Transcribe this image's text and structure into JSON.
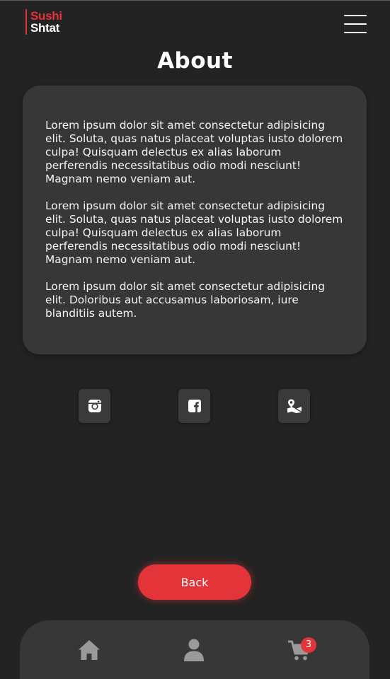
{
  "header": {
    "logo_line1": "Sushi",
    "logo_line2": "Shtat",
    "menu_icon": "hamburger-menu-icon"
  },
  "page": {
    "title": "About"
  },
  "about": {
    "paragraphs": [
      "Lorem ipsum dolor sit amet consectetur adipisicing elit. Soluta, quas natus placeat voluptas iusto dolorem culpa! Quisquam delectus ex alias laborum perferendis necessitatibus odio modi nesciunt! Magnam nemo veniam aut.",
      "Lorem ipsum dolor sit amet consectetur adipisicing elit. Soluta, quas natus placeat voluptas iusto dolorem culpa! Quisquam delectus ex alias laborum perferendis necessitatibus odio modi nesciunt! Magnam nemo veniam aut.",
      "Lorem ipsum dolor sit amet consectetur adipisicing elit. Doloribus aut accusamus laboriosam, iure blanditiis autem."
    ]
  },
  "social": {
    "icons": [
      "instagram-icon",
      "facebook-icon",
      "map-location-icon"
    ]
  },
  "actions": {
    "back_label": "Back"
  },
  "bottom_nav": {
    "items": [
      "home-icon",
      "user-icon",
      "cart-icon"
    ],
    "cart_count": "3"
  },
  "colors": {
    "background": "#232323",
    "card": "#373737",
    "accent": "#e3343a",
    "icon_gray": "#9a9a9a"
  }
}
